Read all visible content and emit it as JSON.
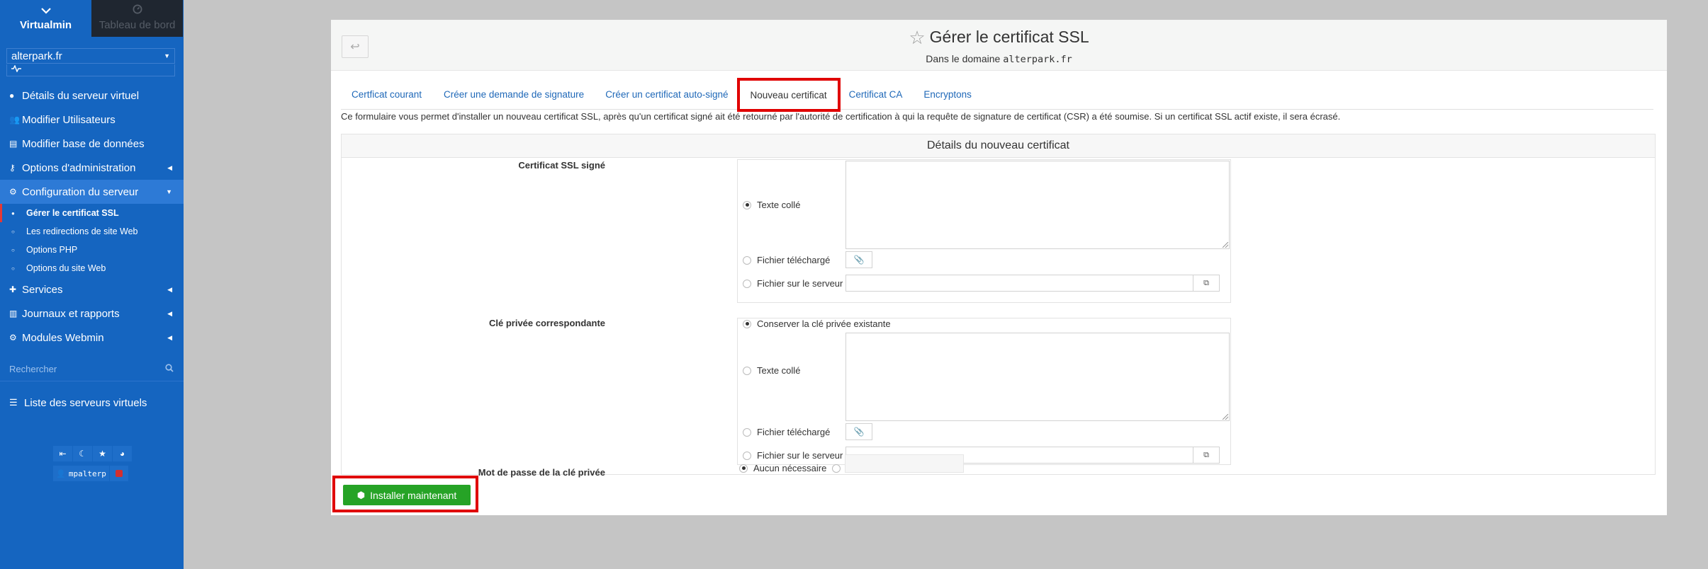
{
  "sidebar": {
    "tabs": [
      {
        "label": "Virtualmin",
        "icon": "chevron-down-icon"
      },
      {
        "label": "Tableau de bord",
        "icon": "dashboard-icon"
      }
    ],
    "domain": "alterpark.fr",
    "activity_icon": "activity-icon",
    "menu": [
      {
        "label": "Détails du serveur virtuel",
        "icon": "info-icon"
      },
      {
        "label": "Modifier Utilisateurs",
        "icon": "users-icon"
      },
      {
        "label": "Modifier base de données",
        "icon": "database-icon"
      },
      {
        "label": "Options d'administration",
        "icon": "key-icon"
      },
      {
        "label": "Configuration du serveur",
        "icon": "cogs-icon"
      }
    ],
    "submenu": [
      {
        "label": "Gérer le certificat SSL"
      },
      {
        "label": "Les redirections de site Web"
      },
      {
        "label": "Options PHP"
      },
      {
        "label": "Options du site Web"
      }
    ],
    "menu2": [
      {
        "label": "Services",
        "icon": "puzzle-icon"
      },
      {
        "label": "Journaux et rapports",
        "icon": "chart-icon"
      },
      {
        "label": "Modules Webmin",
        "icon": "modules-icon"
      }
    ],
    "search_placeholder": "Rechercher",
    "servers_list": "Liste des serveurs virtuels",
    "user": "mpalterp"
  },
  "panel": {
    "title": "Gérer le certificat SSL",
    "subtitle_prefix": "Dans le domaine",
    "subtitle_domain": "alterpark.fr",
    "tabs": [
      {
        "label": "Certficat courant"
      },
      {
        "label": "Créer une demande de signature"
      },
      {
        "label": "Créer un certificat auto-signé"
      },
      {
        "label": "Nouveau certificat"
      },
      {
        "label": "Certificat CA"
      },
      {
        "label": "Encryptons"
      }
    ],
    "intro": "Ce formulaire vous permet d'installer un nouveau certificat SSL, après qu'un certificat signé ait été retourné par l'autorité de certification à qui la requête de signature de certificat (CSR) a été soumise. Si un certificat SSL actif existe, il sera écrasé.",
    "form_title": "Détails du nouveau certificat",
    "cert_label": "Certificat SSL signé",
    "key_label": "Clé privée correspondante",
    "pw_label": "Mot de passe de la clé privée",
    "opt_pasted": "Texte collé",
    "opt_uploaded": "Fichier téléchargé",
    "opt_server": "Fichier sur le serveur",
    "opt_keep": "Conserver la clé privée existante",
    "opt_none": "Aucun nécessaire",
    "install": "Installer maintenant"
  }
}
